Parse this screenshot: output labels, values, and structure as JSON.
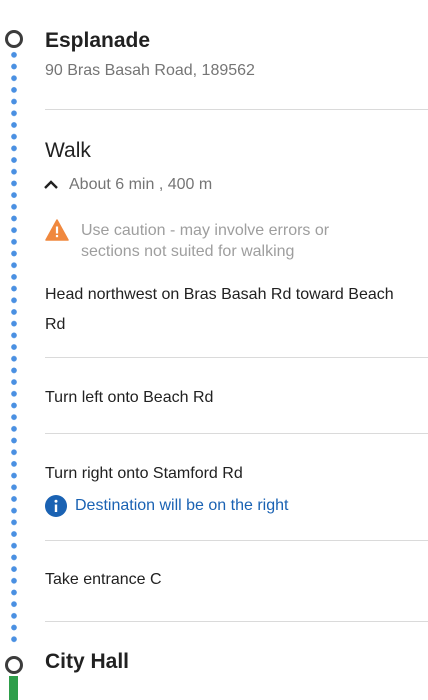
{
  "origin": {
    "name": "Esplanade",
    "address": "90 Bras Basah Road, 189562"
  },
  "walk": {
    "title": "Walk",
    "summary": "About 6 min , 400 m",
    "caution": "Use caution - may involve errors or sections not suited for walking"
  },
  "steps": [
    {
      "text": "Head northwest on Bras Basah Rd toward Beach Rd"
    },
    {
      "text": "Turn left onto Beach Rd"
    },
    {
      "text": "Turn right onto Stamford Rd",
      "note": "Destination will be on the right"
    },
    {
      "text": "Take entrance C"
    }
  ],
  "destination": {
    "name": "City Hall"
  },
  "colors": {
    "walk_dots": "#4a90e2",
    "transit_line": "#2e9e4a",
    "warning": "#f0883e",
    "info": "#1a62b3"
  },
  "icons": {
    "summary_toggle": "chevron-up-icon",
    "caution": "warning-triangle-icon",
    "note": "info-circle-icon"
  }
}
